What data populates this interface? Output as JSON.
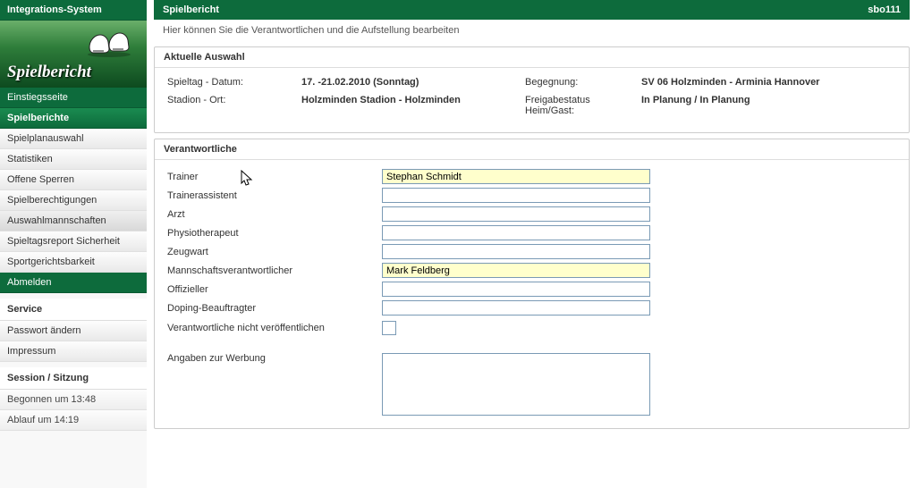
{
  "sidebar": {
    "title": "Integrations-System",
    "banner": "Spielbericht",
    "nav": [
      {
        "label": "Einstiegsseite",
        "style": "green"
      },
      {
        "label": "Spielberichte",
        "style": "green-sel"
      },
      {
        "label": "Spielplanauswahl",
        "style": "grey"
      },
      {
        "label": "Statistiken",
        "style": "grey"
      },
      {
        "label": "Offene Sperren",
        "style": "grey"
      },
      {
        "label": "Spielberechtigungen",
        "style": "grey"
      },
      {
        "label": "Auswahlmannschaften",
        "style": "cur"
      },
      {
        "label": "Spieltagsreport Sicherheit",
        "style": "grey"
      },
      {
        "label": "Sportgerichtsbarkeit",
        "style": "grey"
      },
      {
        "label": "Abmelden",
        "style": "green"
      }
    ],
    "service_head": "Service",
    "service": [
      {
        "label": "Passwort ändern"
      },
      {
        "label": "Impressum"
      }
    ],
    "session_head": "Session / Sitzung",
    "session": [
      {
        "label": "Begonnen um 13:48"
      },
      {
        "label": "Ablauf um 14:19"
      }
    ]
  },
  "header": {
    "title": "Spielbericht",
    "code": "sbo111"
  },
  "subtitle": "Hier können Sie die Verantwortlichen und die Aufstellung bearbeiten",
  "auswahl": {
    "title": "Aktuelle Auswahl",
    "spieltag_lbl": "Spieltag - Datum:",
    "spieltag_val": "17. -21.02.2010 (Sonntag)",
    "begegnung_lbl": "Begegnung:",
    "begegnung_val": "SV 06 Holzminden - Arminia Hannover",
    "stadion_lbl": "Stadion - Ort:",
    "stadion_val": "Holzminden Stadion - Holzminden",
    "freigabe_lbl": "Freigabestatus Heim/Gast:",
    "freigabe_val": "In Planung / In Planung"
  },
  "verantwortliche": {
    "title": "Verantwortliche",
    "fields": [
      {
        "label": "Trainer",
        "value": "Stephan Schmidt",
        "hl": true
      },
      {
        "label": "Trainerassistent",
        "value": "",
        "hl": false
      },
      {
        "label": "Arzt",
        "value": "",
        "hl": false
      },
      {
        "label": "Physiotherapeut",
        "value": "",
        "hl": false
      },
      {
        "label": "Zeugwart",
        "value": "",
        "hl": false
      },
      {
        "label": "Mannschaftsverantwortlicher",
        "value": "Mark Feldberg",
        "hl": true
      },
      {
        "label": "Offizieller",
        "value": "",
        "hl": false
      },
      {
        "label": "Doping-Beauftragter",
        "value": "",
        "hl": false
      }
    ],
    "publish_lbl": "Verantwortliche nicht veröffentlichen",
    "publish_checked": false,
    "werbung_lbl": "Angaben zur Werbung",
    "werbung_val": ""
  }
}
